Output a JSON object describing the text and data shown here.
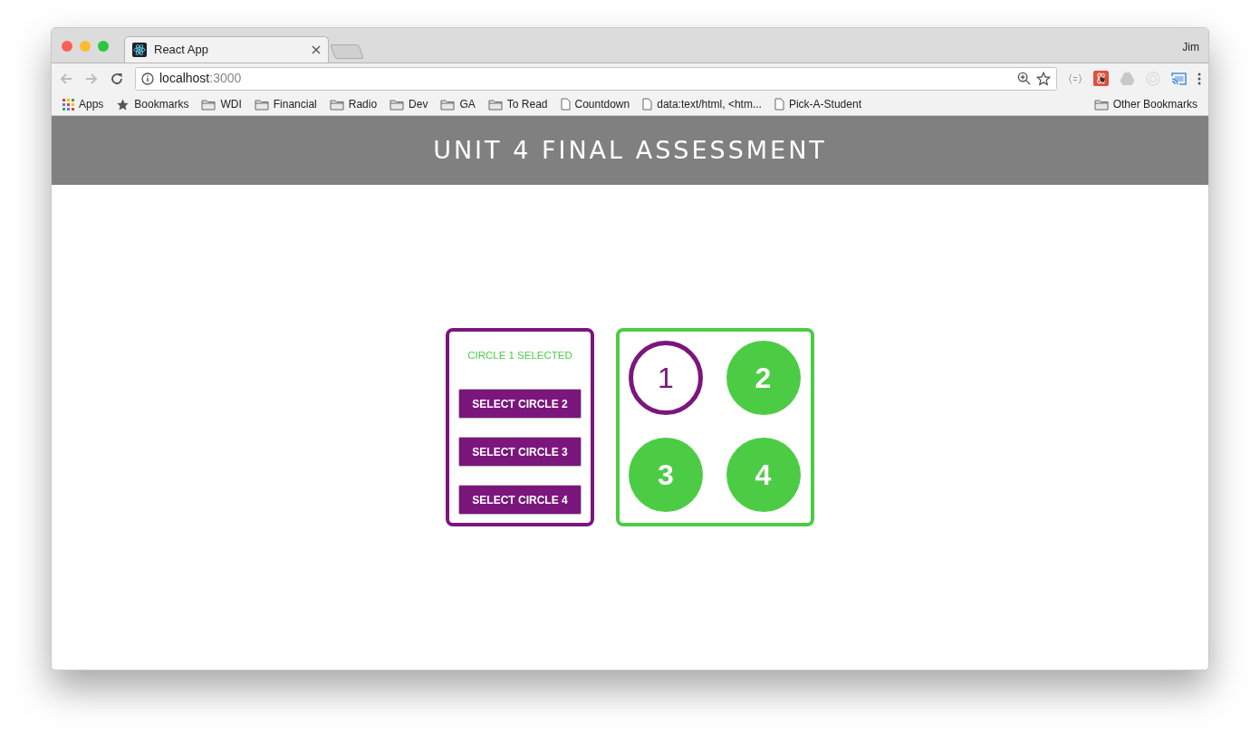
{
  "browser": {
    "tab_title": "React App",
    "user": "Jim",
    "address_host": "localhost",
    "address_port": ":3000"
  },
  "bookmarks": [
    {
      "kind": "apps",
      "label": "Apps"
    },
    {
      "kind": "star",
      "label": "Bookmarks"
    },
    {
      "kind": "folder",
      "label": "WDI"
    },
    {
      "kind": "folder",
      "label": "Financial"
    },
    {
      "kind": "folder",
      "label": "Radio"
    },
    {
      "kind": "folder",
      "label": "Dev"
    },
    {
      "kind": "folder",
      "label": "GA"
    },
    {
      "kind": "folder",
      "label": "To Read"
    },
    {
      "kind": "page",
      "label": "Countdown"
    },
    {
      "kind": "page",
      "label": "data:text/html, <htm..."
    },
    {
      "kind": "page",
      "label": "Pick-A-Student"
    }
  ],
  "other_bookmarks": "Other Bookmarks",
  "header": {
    "title": "UNIT 4 FINAL ASSESSMENT"
  },
  "controls": {
    "status": "CIRCLE 1 SELECTED",
    "buttons": [
      "SELECT CIRCLE 2",
      "SELECT CIRCLE 3",
      "SELECT CIRCLE 4"
    ]
  },
  "circles": [
    {
      "label": "1",
      "selected": true
    },
    {
      "label": "2",
      "selected": false
    },
    {
      "label": "3",
      "selected": false
    },
    {
      "label": "4",
      "selected": false
    }
  ]
}
